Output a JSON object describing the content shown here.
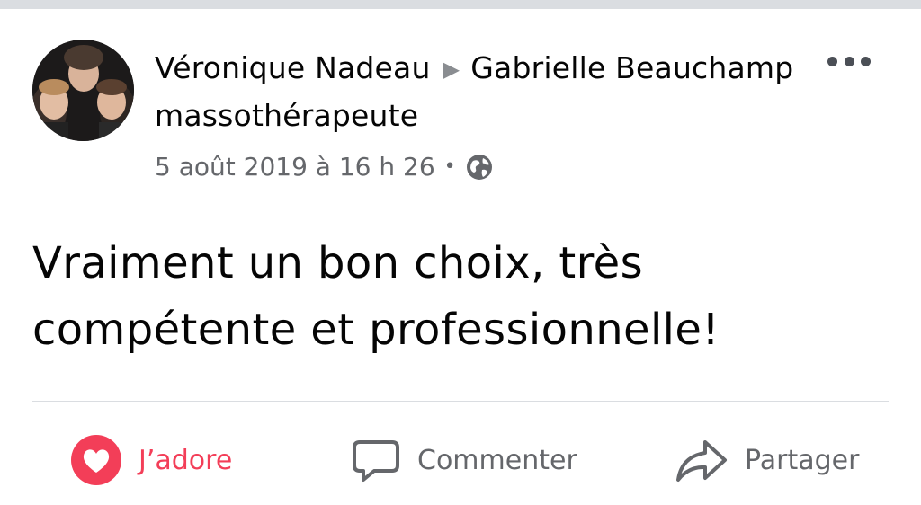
{
  "post": {
    "author": "Véronique Nadeau",
    "arrow_glyph": "▶",
    "recipient": "Gabrielle Beauchamp massothérapeute",
    "timestamp": "5 août 2019 à 16 h 26",
    "separator": "•",
    "privacy_icon": "globe-icon",
    "text": "Vraiment un bon choix, très compétente et professionnelle!"
  },
  "actions": {
    "love_label": "J’adore",
    "comment_label": "Commenter",
    "share_label": "Partager"
  },
  "colors": {
    "love_accent": "#f33e58",
    "secondary_text": "#65676b",
    "divider": "#dadde1"
  }
}
